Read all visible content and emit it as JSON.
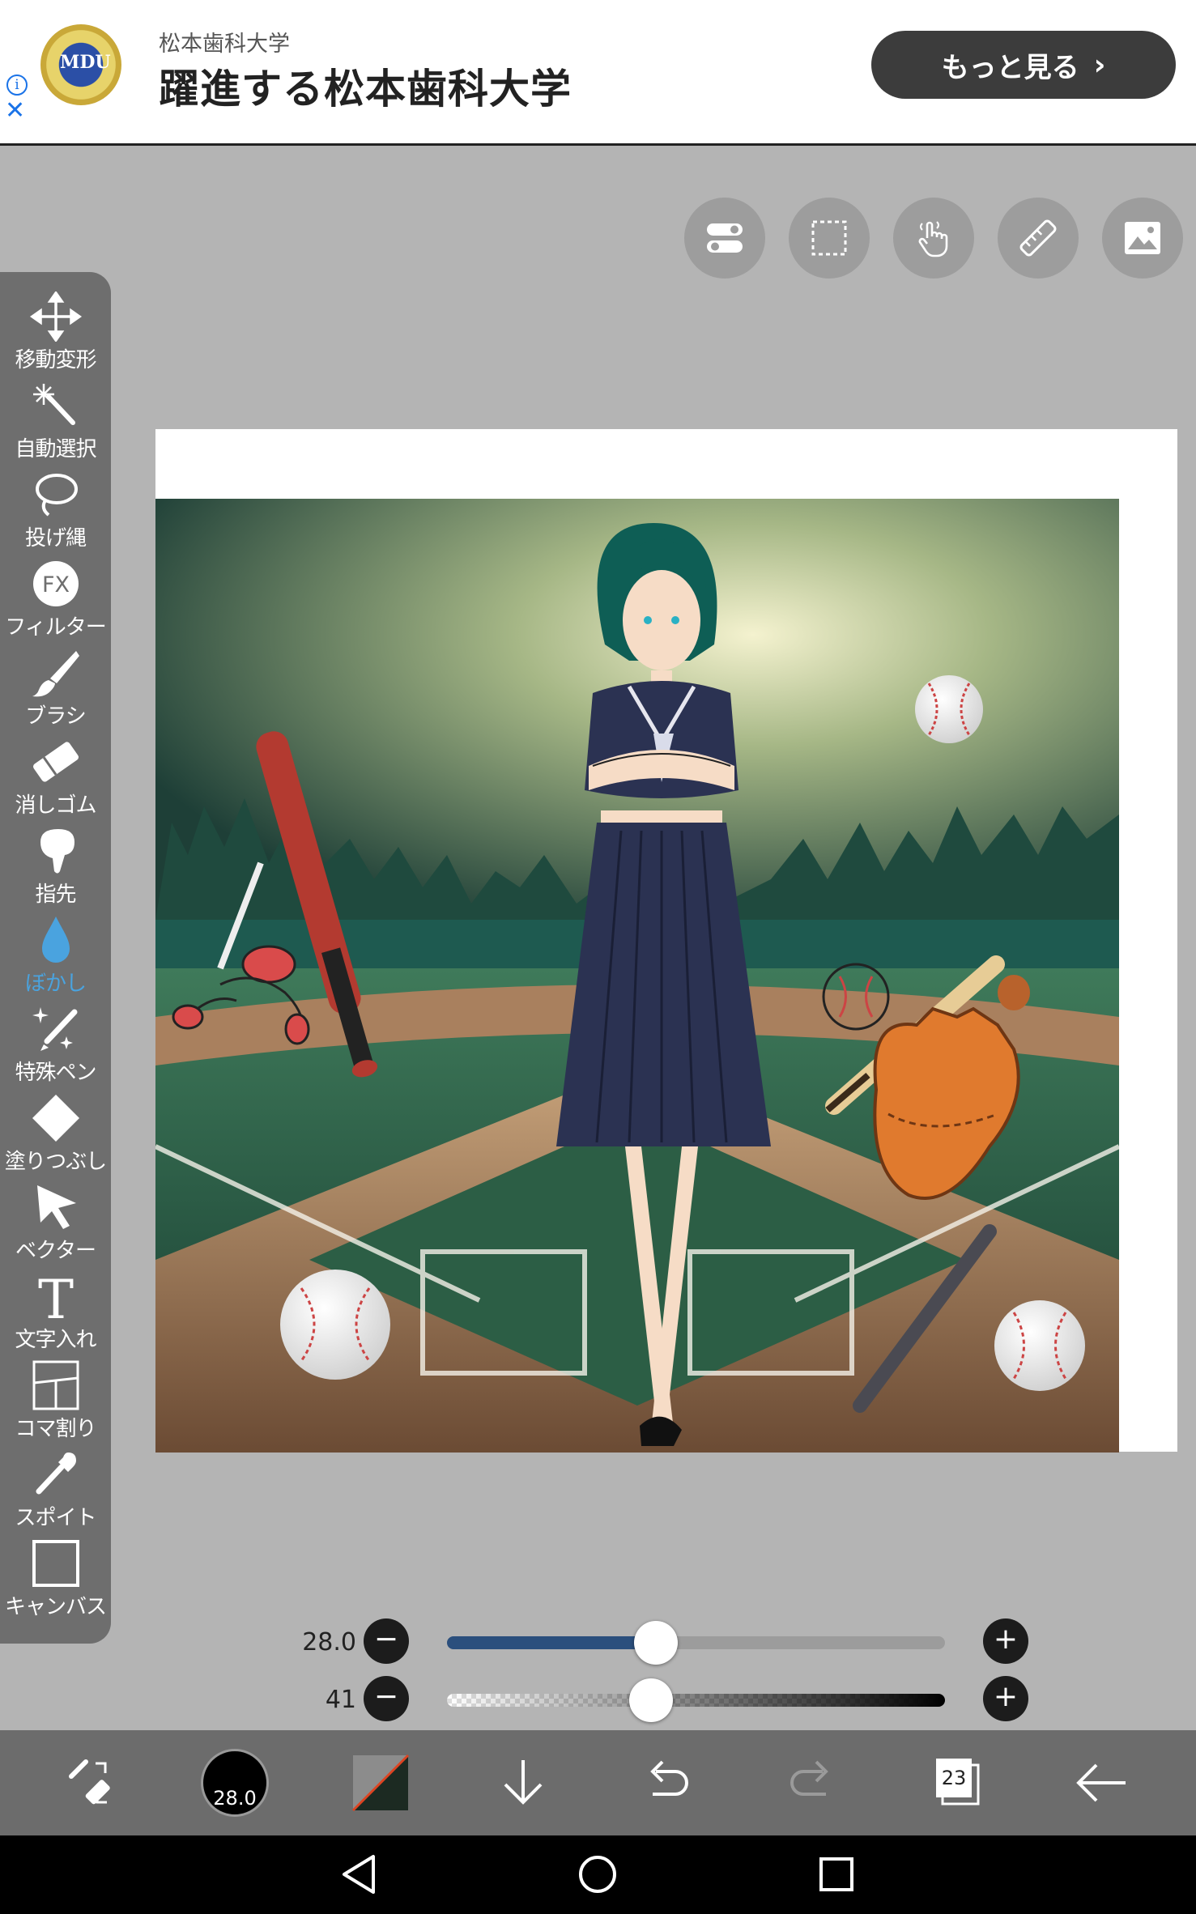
{
  "ad": {
    "sub": "松本歯科大学",
    "title": "躍進する松本歯科大学",
    "cta": "もっと見る",
    "logo_letters": "MDU",
    "info_icon": "info-icon",
    "close_icon": "close-icon"
  },
  "top_tools": [
    {
      "name": "toggle-icon"
    },
    {
      "name": "selection-icon"
    },
    {
      "name": "hand-icon"
    },
    {
      "name": "ruler-icon"
    },
    {
      "name": "image-icon"
    }
  ],
  "tools": [
    {
      "label": "移動変形",
      "icon": "move-icon"
    },
    {
      "label": "自動選択",
      "icon": "magic-wand-icon"
    },
    {
      "label": "投げ縄",
      "icon": "lasso-icon"
    },
    {
      "label": "フィルター",
      "icon": "fx-icon"
    },
    {
      "label": "ブラシ",
      "icon": "brush-icon"
    },
    {
      "label": "消しゴム",
      "icon": "eraser-icon"
    },
    {
      "label": "指先",
      "icon": "finger-icon"
    },
    {
      "label": "ぼかし",
      "icon": "blur-drop-icon",
      "active": true
    },
    {
      "label": "特殊ペン",
      "icon": "special-pen-icon"
    },
    {
      "label": "塗りつぶし",
      "icon": "fill-icon"
    },
    {
      "label": "ベクター",
      "icon": "vector-icon"
    },
    {
      "label": "文字入れ",
      "icon": "text-icon"
    },
    {
      "label": "コマ割り",
      "icon": "panel-icon"
    },
    {
      "label": "スポイト",
      "icon": "eyedropper-icon"
    },
    {
      "label": "キャンバス",
      "icon": "canvas-icon"
    }
  ],
  "fx_text": "FX",
  "text_tool_glyph": "T",
  "sliders": {
    "size": {
      "value": "28.0",
      "fraction": 0.42
    },
    "opacity": {
      "value": "41",
      "fraction": 0.41
    }
  },
  "bottom": {
    "brush_size": "28.0",
    "layer_count": "23"
  },
  "colors": {
    "accent": "#4aa3df",
    "slider_fill": "#2b4f7d",
    "toolbar": "#6e6e6e",
    "bottombar": "#6c6c6c"
  }
}
